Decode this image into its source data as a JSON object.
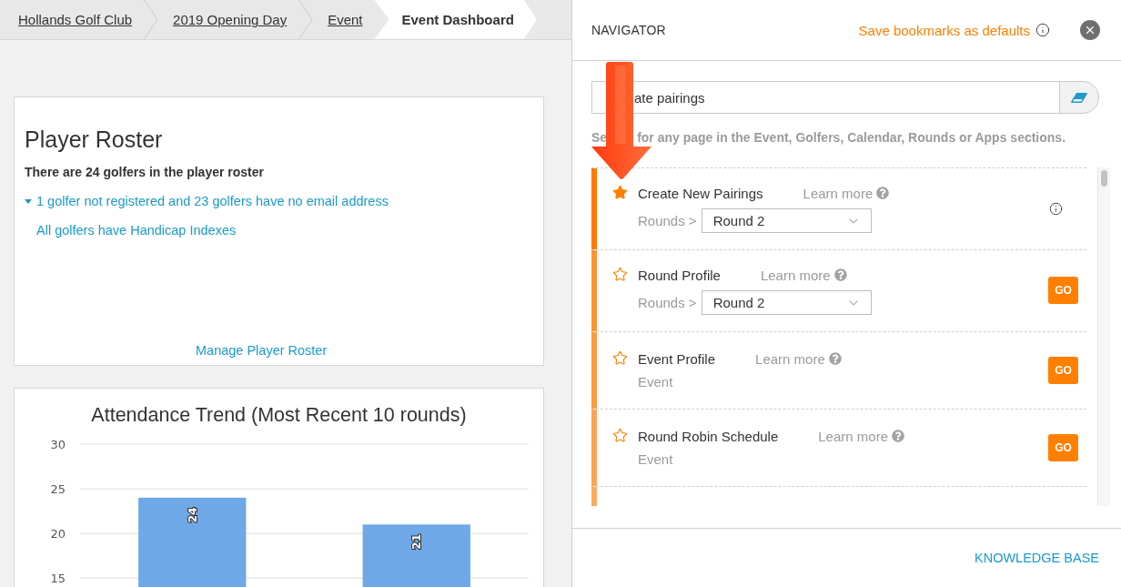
{
  "breadcrumbs": [
    {
      "label": "Hollands Golf Club",
      "selected": false
    },
    {
      "label": "2019 Opening Day",
      "selected": false
    },
    {
      "label": "Event",
      "selected": false
    },
    {
      "label": "Event Dashboard",
      "selected": true
    }
  ],
  "player_roster": {
    "title": "Player Roster",
    "summary": "There are 24 golfers in the player roster",
    "issues_link": "1 golfer not registered and 23 golfers have no email address",
    "handicap_link": "All golfers have Handicap Indexes",
    "manage_link": "Manage Player Roster"
  },
  "attendance": {
    "chart_data": {
      "type": "bar",
      "title": "Attendance Trend (Most Recent 10 rounds)",
      "values": [
        24,
        21
      ],
      "ylim": [
        14,
        30
      ],
      "yticks": [
        15,
        20,
        25,
        30
      ],
      "grid": true,
      "data_labels": true
    }
  },
  "navigator": {
    "title": "NAVIGATOR",
    "save_link": "Save bookmarks as defaults",
    "search": {
      "value": "ate pairings"
    },
    "hint": {
      "lead": "Se",
      "rest": "for any page in the Event, Golfers, Calendar, Rounds or Apps sections."
    },
    "items": [
      {
        "kind": "round",
        "title": "Create New Pairings",
        "bookmarked": true,
        "color": "#ff7a00",
        "learn_more": "Learn more",
        "scope": "Rounds >",
        "select": "Round 2",
        "action": {
          "kind": "info"
        }
      },
      {
        "kind": "round",
        "title": "Round Profile",
        "bookmarked": false,
        "color": "#ff9331",
        "learn_more": "Learn more",
        "scope": "Rounds >",
        "select": "Round 2",
        "action": {
          "kind": "button",
          "label": "GO"
        }
      },
      {
        "kind": "event",
        "title": "Event Profile",
        "bookmarked": false,
        "color": "#ff9a3e",
        "learn_more": "Learn more",
        "scope": "Event",
        "action": {
          "kind": "button",
          "label": "GO"
        }
      },
      {
        "kind": "event",
        "title": "Round Robin Schedule",
        "bookmarked": false,
        "color": "#ffa352",
        "learn_more": "Learn more",
        "scope": "Event",
        "action": {
          "kind": "button",
          "label": "GO"
        }
      },
      {
        "kind": "cut",
        "color": "#ffa95c"
      }
    ],
    "footer_link": "KNOWLEDGE BASE"
  }
}
